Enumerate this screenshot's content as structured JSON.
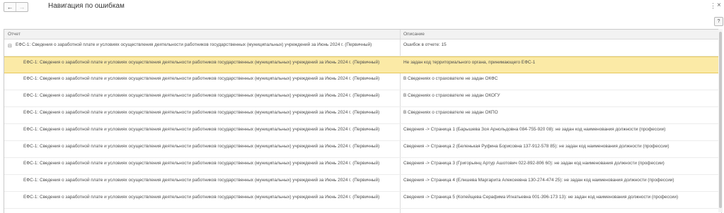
{
  "window": {
    "title": "Навигация по ошибкам",
    "back_glyph": "←",
    "forward_glyph": "→",
    "more_glyph": "⋮",
    "close_glyph": "×",
    "help_label": "?"
  },
  "table": {
    "columns": [
      "Отчет",
      "Описание"
    ],
    "parent": {
      "expander": "⊟",
      "report": "ЕФС-1: Сведения о заработной плате и условиях осуществления деятельности работников государственных (муниципальных) учреждений за Июнь 2024 г. (Первичный)",
      "description": "Ошибок в отчете: 15"
    },
    "rows": [
      {
        "report": "ЕФС-1: Сведения о заработной плате и условиях осуществления деятельности работников государственных (муниципальных) учреждений за Июнь 2024 г. (Первичный)",
        "description": "Не задан код территориального органа, принимающего ЕФС-1",
        "selected": true
      },
      {
        "report": "ЕФС-1: Сведения о заработной плате и условиях осуществления деятельности работников государственных (муниципальных) учреждений за Июнь 2024 г. (Первичный)",
        "description": "В Сведениях о страхователе не задан ОКФС",
        "selected": false
      },
      {
        "report": "ЕФС-1: Сведения о заработной плате и условиях осуществления деятельности работников государственных (муниципальных) учреждений за Июнь 2024 г. (Первичный)",
        "description": "В Сведениях о страхователе не задан ОКОГУ",
        "selected": false
      },
      {
        "report": "ЕФС-1: Сведения о заработной плате и условиях осуществления деятельности работников государственных (муниципальных) учреждений за Июнь 2024 г. (Первичный)",
        "description": "В Сведениях о страхователе не задан ОКПО",
        "selected": false
      },
      {
        "report": "ЕФС-1: Сведения о заработной плате и условиях осуществления деятельности работников государственных (муниципальных) учреждений за Июнь 2024 г. (Первичный)",
        "description": "Сведения -> Страница 1 (Барышева Зоя Арнольдовна 084-755-920 08): не задан код наименования должности (профессии)",
        "selected": false
      },
      {
        "report": "ЕФС-1: Сведения о заработной плате и условиях осуществления деятельности работников государственных (муниципальных) учреждений за Июнь 2024 г. (Первичный)",
        "description": "Сведения -> Страница 2 (Беленькая Руфина Борисовна 137-912-578 85): не задан код наименования должности (профессии)",
        "selected": false
      },
      {
        "report": "ЕФС-1: Сведения о заработной плате и условиях осуществления деятельности работников государственных (муниципальных) учреждений за Июнь 2024 г. (Первичный)",
        "description": "Сведения -> Страница 3 (Григорьянц Артур Ашотович 022-892-806 60): не задан код наименования должности (профессии)",
        "selected": false
      },
      {
        "report": "ЕФС-1: Сведения о заработной плате и условиях осуществления деятельности работников государственных (муниципальных) учреждений за Июнь 2024 г. (Первичный)",
        "description": "Сведения -> Страница 4 (Елншева Маргарита Алексеевна 130-274-474 25): не задан код наименования должности (профессии)",
        "selected": false
      },
      {
        "report": "ЕФС-1: Сведения о заработной плате и условиях осуществления деятельности работников государственных (муниципальных) учреждений за Июнь 2024 г. (Первичный)",
        "description": "Сведения -> Страница 5 (Копейщева Серафима Игнатьевна 001-396-173 13): не задан код наименования должности (профессии)",
        "selected": false
      }
    ]
  }
}
